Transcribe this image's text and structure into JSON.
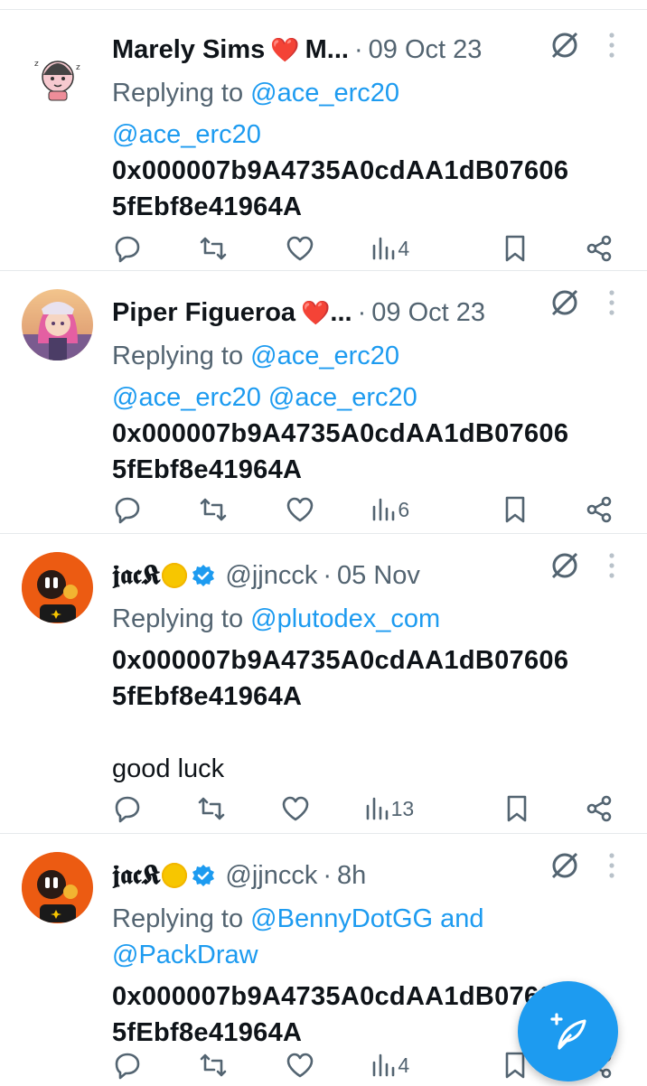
{
  "tweets": [
    {
      "name": "Marely Sims ❤️ M...",
      "name_text": "Marely Sims",
      "name_suffix": "M...",
      "handle": "",
      "date": "09 Oct 23",
      "replying_prefix": "Replying to ",
      "replying_to": "@ace_erc20",
      "replying_to_2": "",
      "mentions": "@ace_erc20",
      "body_line1": "0x000007b9A4735A0cdAA1dB07606",
      "body_line2": "5fEbf8e41964A",
      "body_extra": "",
      "views": "4"
    },
    {
      "name_text": "Piper Figueroa",
      "name_suffix": "...",
      "date": "09 Oct 23",
      "replying_prefix": "Replying to ",
      "replying_to": "@ace_erc20",
      "mentions": "@ace_erc20 @ace_erc20",
      "body_line1": "0x000007b9A4735A0cdAA1dB07606",
      "body_line2": "5fEbf8e41964A",
      "views": "6"
    },
    {
      "name_text": "𝖏𝖆𝖈𝕶",
      "handle": "@jjncck",
      "date": "05 Nov",
      "replying_prefix": "Replying to ",
      "replying_to": "@plutodex_com",
      "body_line1": "0x000007b9A4735A0cdAA1dB07606",
      "body_line2": "5fEbf8e41964A",
      "body_extra": "good luck",
      "views": "13"
    },
    {
      "name_text": "𝖏𝖆𝖈𝕶",
      "handle": "@jjncck",
      "date": "8h",
      "replying_prefix": "Replying to ",
      "replying_to": "@BennyDotGG and",
      "replying_to_2": "@PackDraw",
      "body_line1": "0x000007b9A4735A0cdAA1dB07606",
      "body_line2": "5fEbf8e41964A",
      "views": "4"
    }
  ],
  "icons": {
    "reply": "reply-icon",
    "retweet": "retweet-icon",
    "like": "heart-icon",
    "views": "views-icon",
    "bookmark": "bookmark-icon",
    "share": "share-icon",
    "mute": "mute-icon",
    "more": "more-vertical-icon",
    "compose": "compose-icon"
  },
  "colors": {
    "accent": "#1d9bf0",
    "muted": "#536471",
    "heart": "#e0245e",
    "verified": "#1d9bf0"
  }
}
